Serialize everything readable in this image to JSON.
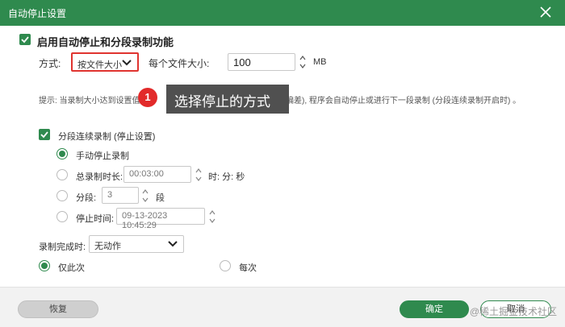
{
  "window": {
    "title": "自动停止设置"
  },
  "main_option": {
    "label": "启用自动停止和分段录制功能",
    "checked": true
  },
  "mode": {
    "label": "方式:",
    "selected": "按文件大小"
  },
  "file_size": {
    "label": "每个文件大小:",
    "value": "100",
    "unit": "MB"
  },
  "hint": {
    "part1": "提示: 当录制大小达到设置值",
    "part2": "一定的偏差), 程序会自动停止或进行下一段录制 (分段连续录制开启时) 。"
  },
  "callout": {
    "number": "1",
    "text": "选择停止的方式"
  },
  "segmented": {
    "label": "分段连续录制 (停止设置)",
    "checked": true
  },
  "options": {
    "manual": {
      "label": "手动停止录制",
      "selected": true
    },
    "duration": {
      "label": "总录制时长:",
      "value": "00:03:00",
      "suffix": "时: 分: 秒"
    },
    "segments": {
      "label": "分段:",
      "value": "3",
      "suffix": "段"
    },
    "stop_time": {
      "label": "停止时间:",
      "value": "09-13-2023 10:45:29"
    }
  },
  "on_complete": {
    "label": "录制完成时:",
    "selected": "无动作"
  },
  "repeat": {
    "once": "仅此次",
    "every": "每次",
    "selected": "once"
  },
  "buttons": {
    "reset": "恢复",
    "ok": "确定",
    "cancel": "取消"
  },
  "watermark": "@稀土掘金技术社区",
  "colors": {
    "accent": "#2f8a4e",
    "highlight": "#e0342f",
    "badge": "#e22a2a",
    "tooltip": "#505050"
  }
}
